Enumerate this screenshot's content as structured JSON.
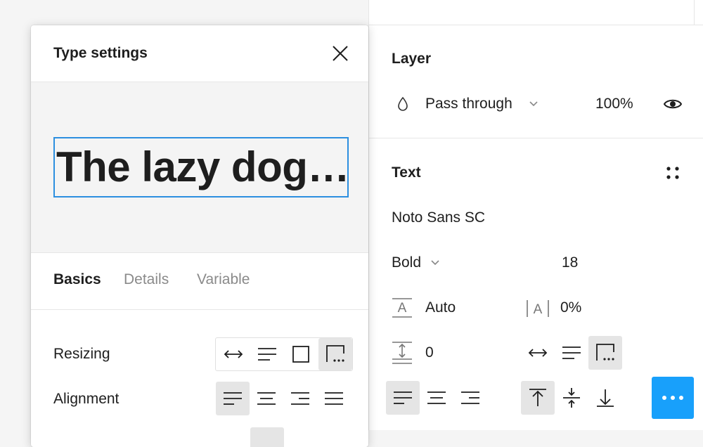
{
  "properties_panel": {
    "layer": {
      "title": "Layer",
      "blend_mode": "Pass through",
      "opacity": "100%"
    },
    "text": {
      "title": "Text",
      "font_family": "Noto Sans SC",
      "font_weight": "Bold",
      "font_size": "18",
      "line_height": "Auto",
      "letter_spacing": "0%",
      "paragraph_spacing": "0"
    },
    "icons": {
      "blend": "drop-icon",
      "visibility": "eye-icon",
      "styles": "four-dots-icon",
      "line_height": "line-height-icon",
      "letter_spacing": "letter-spacing-icon",
      "paragraph_spacing": "paragraph-spacing-icon"
    },
    "accent_color": "#18a0fb"
  },
  "type_settings": {
    "title": "Type settings",
    "preview_text": "The lazy dog…",
    "tabs": [
      "Basics",
      "Details",
      "Variable"
    ],
    "active_tab": "Basics",
    "resizing_label": "Resizing",
    "alignment_label": "Alignment",
    "selection_border_color": "#2c8fe0"
  }
}
